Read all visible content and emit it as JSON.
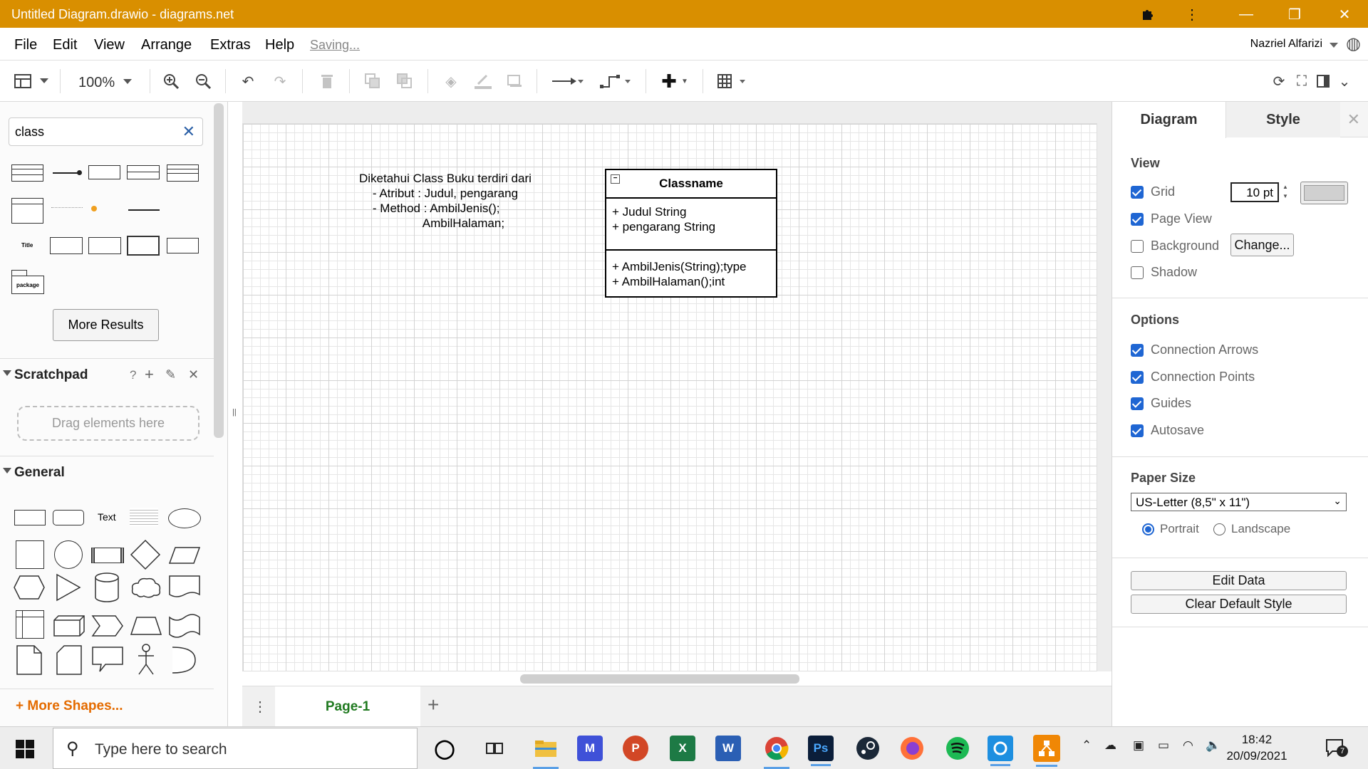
{
  "window": {
    "title": "Untitled Diagram.drawio - diagrams.net"
  },
  "titlebar_icons": [
    "puzzle-icon",
    "more-vert-icon",
    "minimize-icon",
    "restore-icon",
    "close-icon"
  ],
  "menu": {
    "items": [
      "File",
      "Edit",
      "View",
      "Arrange",
      "Extras",
      "Help"
    ],
    "status": "Saving...",
    "user": "Nazriel Alfarizi"
  },
  "toolbar": {
    "zoom": "100%",
    "icons": [
      "panel-toggle-icon",
      "zoom-in-icon",
      "zoom-out-icon",
      "undo-icon",
      "redo-icon",
      "delete-icon",
      "to-front-icon",
      "to-back-icon",
      "fill-color-icon",
      "line-color-icon",
      "shadow-icon",
      "connection-icon",
      "waypoints-icon",
      "insert-icon",
      "table-icon",
      "refresh-icon",
      "fullscreen-icon",
      "format-panel-icon",
      "collapse-icon"
    ]
  },
  "sidebar": {
    "search_value": "class",
    "more_results": "More Results",
    "scratchpad": {
      "title": "Scratchpad",
      "help": "?",
      "drop_hint": "Drag elements here"
    },
    "general": {
      "title": "General",
      "text_shape": "Text"
    },
    "more_shapes": "+ More Shapes...",
    "class_shape_labels": {
      "title": "Title",
      "package": "package"
    }
  },
  "diagram": {
    "note_lines": [
      "Diketahui Class Buku terdiri dari",
      "    - Atribut : Judul, pengarang",
      "    - Method : AmbilJenis();",
      "                   AmbilHalaman;"
    ],
    "uml": {
      "name": "Classname",
      "attributes": [
        "+ Judul String",
        "+ pengarang String"
      ],
      "methods": [
        "+ AmbilJenis(String);type",
        "+ AmbilHalaman();int"
      ]
    }
  },
  "pages": {
    "tab": "Page-1"
  },
  "format_panel": {
    "tabs": [
      "Diagram",
      "Style"
    ],
    "view": {
      "title": "View",
      "grid": {
        "label": "Grid",
        "checked": true,
        "size": "10 pt",
        "color": "#d0d0d0"
      },
      "page_view": {
        "label": "Page View",
        "checked": true
      },
      "background": {
        "label": "Background",
        "checked": false,
        "button": "Change..."
      },
      "shadow": {
        "label": "Shadow",
        "checked": false
      }
    },
    "options": {
      "title": "Options",
      "items": [
        {
          "label": "Connection Arrows",
          "checked": true
        },
        {
          "label": "Connection Points",
          "checked": true
        },
        {
          "label": "Guides",
          "checked": true
        },
        {
          "label": "Autosave",
          "checked": true
        }
      ]
    },
    "paper": {
      "title": "Paper Size",
      "selected": "US-Letter (8,5\" x 11\")",
      "portrait": "Portrait",
      "landscape": "Landscape",
      "orientation": "portrait"
    },
    "buttons": {
      "edit_data": "Edit Data",
      "clear_style": "Clear Default Style"
    }
  },
  "taskbar": {
    "search_placeholder": "Type here to search",
    "apps": [
      "cortana",
      "task-view",
      "file-explorer",
      "app-m",
      "powerpoint",
      "excel",
      "word",
      "chrome",
      "photoshop",
      "steam",
      "firefox",
      "spotify",
      "app-circle",
      "drawio"
    ],
    "clock": {
      "time": "18:42",
      "date": "20/09/2021"
    },
    "notifications": "7"
  },
  "colors": {
    "titlebar": "#d98f00",
    "accent": "#1f66d3",
    "page_tab": "#207a20",
    "more_shapes": "#e46b00"
  }
}
